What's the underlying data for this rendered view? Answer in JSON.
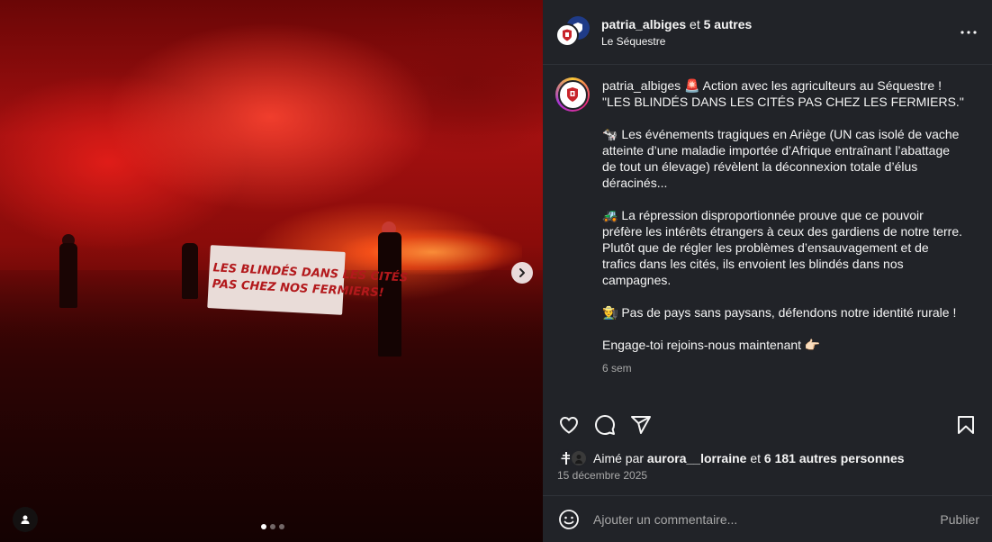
{
  "header": {
    "username": "patria_albiges",
    "joiner": "et",
    "others": "5 autres",
    "location": "Le Séquestre"
  },
  "media": {
    "banner_line1": "LES BLINDÉS DANS LES CITÉS",
    "banner_line2": "PAS CHEZ NOS FERMIERS!",
    "carousel_dots": 3,
    "active_dot": 1
  },
  "caption": {
    "username": "patria_albiges",
    "line1": "🚨 Action avec les agriculteurs au Séquestre !",
    "line2": "\"LES BLINDÉS DANS LES CITÉS PAS CHEZ LES FERMIERS.\"",
    "para2": "🐄 Les événements tragiques en Ariège (UN cas isolé de vache atteinte d’une maladie importée d’Afrique entraînant l’abattage de tout un élevage) révèlent la déconnexion totale d’élus déracinés...",
    "para3": "🚜 La répression disproportionnée prouve que ce pouvoir préfère les intérêts étrangers à ceux des gardiens de notre terre. Plutôt que de régler les problèmes d’ensauvagement et de trafics dans les cités, ils envoient les blindés dans nos campagnes.",
    "para4": "👨‍🌾 Pas de pays sans paysans, défendons notre identité rurale !",
    "para5": "Engage-toi rejoins-nous maintenant 👉🏻",
    "time_ago": "6 sem"
  },
  "likes": {
    "prefix": "Aimé par",
    "user": "aurora__lorraine",
    "joiner": "et",
    "count_text": "6 181 autres personnes"
  },
  "post_date": "15 décembre 2025",
  "comment": {
    "placeholder": "Ajouter un commentaire...",
    "publish_label": "Publier"
  },
  "icons": {
    "more": "more-horizontal-icon",
    "like": "heart-icon",
    "comment": "comment-icon",
    "share": "share-icon",
    "save": "bookmark-icon",
    "emoji": "emoji-icon",
    "next": "chevron-right-icon",
    "tags": "user-tag-icon"
  },
  "colors": {
    "panel_bg": "#212328",
    "text_primary": "#f5f5f5",
    "text_secondary": "#a8a8a8",
    "banner_text": "#b3191c"
  }
}
